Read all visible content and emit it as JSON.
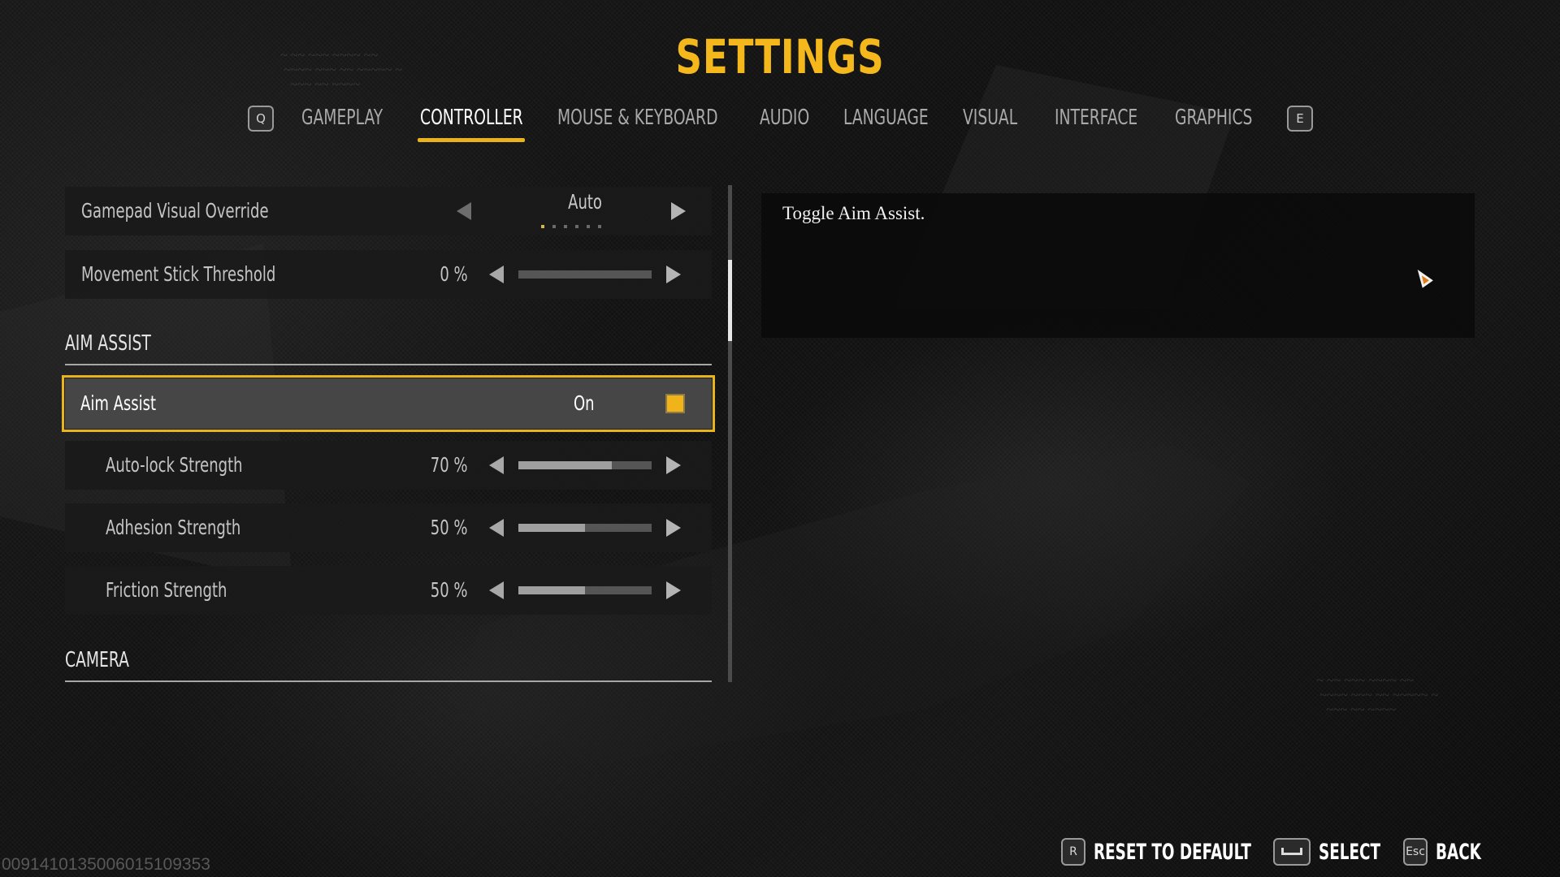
{
  "header": {
    "title": "SETTINGS"
  },
  "tabs": {
    "prev_key": "Q",
    "next_key": "E",
    "items": [
      {
        "label": "GAMEPLAY",
        "active": false
      },
      {
        "label": "CONTROLLER",
        "active": true
      },
      {
        "label": "MOUSE & KEYBOARD",
        "active": false
      },
      {
        "label": "AUDIO",
        "active": false
      },
      {
        "label": "LANGUAGE",
        "active": false
      },
      {
        "label": "VISUAL",
        "active": false
      },
      {
        "label": "INTERFACE",
        "active": false
      },
      {
        "label": "GRAPHICS",
        "active": false
      }
    ]
  },
  "settings": {
    "gamepad_visual_override": {
      "label": "Gamepad Visual Override",
      "value": "Auto",
      "option_count": 6,
      "selected_index": 0
    },
    "movement_stick_threshold": {
      "label": "Movement Stick Threshold",
      "value_text": "0 %",
      "percent": 0
    },
    "aim_assist_section": {
      "label": "AIM ASSIST"
    },
    "aim_assist": {
      "label": "Aim Assist",
      "value": "On",
      "checked": true
    },
    "auto_lock_strength": {
      "label": "Auto-lock Strength",
      "value_text": "70 %",
      "percent": 70
    },
    "adhesion_strength": {
      "label": "Adhesion Strength",
      "value_text": "50 %",
      "percent": 50
    },
    "friction_strength": {
      "label": "Friction Strength",
      "value_text": "50 %",
      "percent": 50
    },
    "camera_section": {
      "label": "CAMERA"
    }
  },
  "description": {
    "text": "Toggle Aim Assist."
  },
  "footer": {
    "reset": {
      "key": "R",
      "label": "RESET TO DEFAULT"
    },
    "select": {
      "key": "space-icon",
      "label": "SELECT"
    },
    "back": {
      "key": "Esc",
      "label": "BACK"
    }
  },
  "serial_number": "0091410135006015109353",
  "colors": {
    "accent": "#f5b81c",
    "selected_border": "#e8b41e",
    "checkbox_fill": "#f0b41a"
  }
}
